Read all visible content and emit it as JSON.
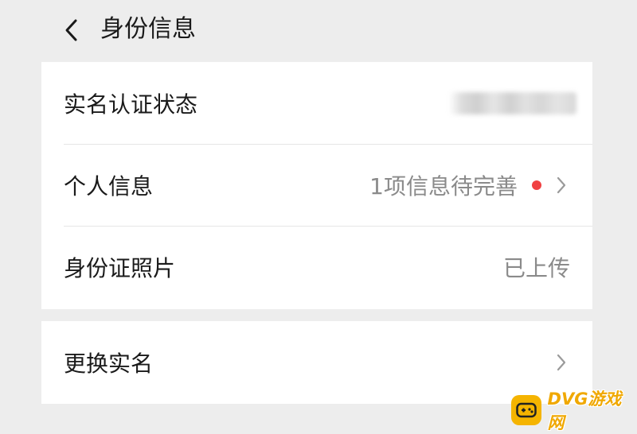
{
  "header": {
    "title": "身份信息",
    "back_icon": "chevron-left-icon"
  },
  "identity_card": {
    "rows": [
      {
        "label": "实名认证状态",
        "value": ""
      },
      {
        "label": "个人信息",
        "value": "1项信息待完善",
        "badge_color": "#f04142",
        "icon": "chevron-right-icon"
      },
      {
        "label": "身份证照片",
        "value": "已上传"
      }
    ]
  },
  "actions_card": {
    "rows": [
      {
        "label": "更换实名",
        "icon": "chevron-right-icon"
      }
    ]
  },
  "watermark": {
    "text": "DVG游戏网"
  },
  "colors": {
    "background": "#ededed",
    "card": "#ffffff",
    "primary_text": "#1a1a1a",
    "secondary_text": "#8a8a8a",
    "badge": "#f04142",
    "watermark": "#f5b400"
  }
}
